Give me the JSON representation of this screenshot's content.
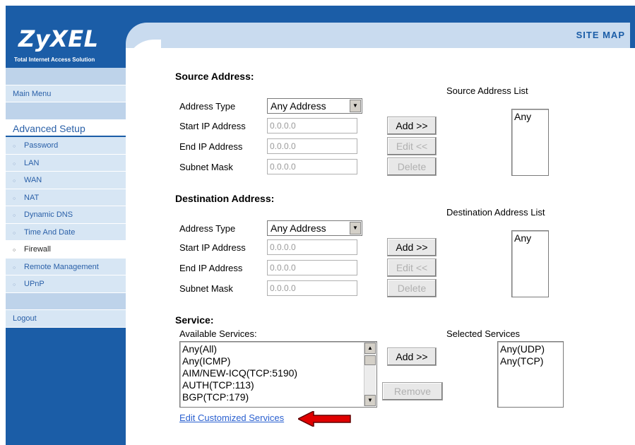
{
  "brand": {
    "logo": "ZyXEL",
    "tagline": "Total Internet Access Solution"
  },
  "header": {
    "site_map": "SITE MAP"
  },
  "sidebar": {
    "main_menu": "Main Menu",
    "advanced_setup": "Advanced Setup",
    "items": [
      {
        "label": "Password"
      },
      {
        "label": "LAN"
      },
      {
        "label": "WAN"
      },
      {
        "label": "NAT"
      },
      {
        "label": "Dynamic DNS"
      },
      {
        "label": "Time And Date"
      },
      {
        "label": "Firewall"
      },
      {
        "label": "Remote Management"
      },
      {
        "label": "UPnP"
      }
    ],
    "logout": "Logout"
  },
  "source": {
    "title": "Source Address:",
    "list_title": "Source Address List",
    "address_type_label": "Address Type",
    "address_type_value": "Any Address",
    "start_ip_label": "Start IP Address",
    "start_ip_value": "0.0.0.0",
    "end_ip_label": "End IP Address",
    "end_ip_value": "0.0.0.0",
    "subnet_label": "Subnet Mask",
    "subnet_value": "0.0.0.0",
    "list": [
      "Any"
    ]
  },
  "destination": {
    "title": "Destination Address:",
    "list_title": "Destination Address List",
    "address_type_label": "Address Type",
    "address_type_value": "Any Address",
    "start_ip_label": "Start IP Address",
    "start_ip_value": "0.0.0.0",
    "end_ip_label": "End IP Address",
    "end_ip_value": "0.0.0.0",
    "subnet_label": "Subnet Mask",
    "subnet_value": "0.0.0.0",
    "list": [
      "Any"
    ]
  },
  "buttons": {
    "add": "Add >>",
    "edit": "Edit <<",
    "delete": "Delete",
    "remove": "Remove"
  },
  "service": {
    "title": "Service:",
    "available_label": "Available Services:",
    "selected_label": "Selected Services",
    "available": [
      "Any(All)",
      "Any(ICMP)",
      "AIM/NEW-ICQ(TCP:5190)",
      "AUTH(TCP:113)",
      "BGP(TCP:179)"
    ],
    "selected": [
      "Any(UDP)",
      "Any(TCP)"
    ],
    "edit_link": "Edit Customized Services"
  },
  "colors": {
    "sidebar": "#1b5da7",
    "link": "#2a60d0",
    "arrow": "#e00000"
  }
}
